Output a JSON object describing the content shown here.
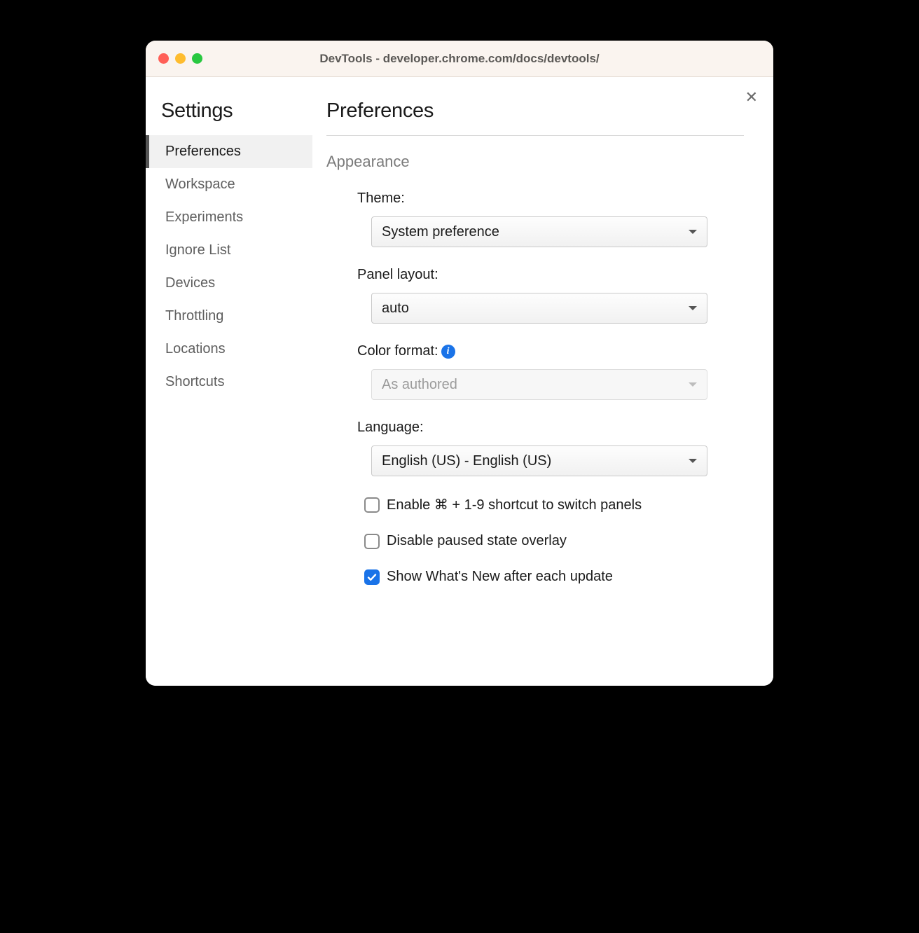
{
  "window": {
    "title": "DevTools - developer.chrome.com/docs/devtools/"
  },
  "sidebar": {
    "title": "Settings",
    "items": [
      {
        "label": "Preferences",
        "active": true
      },
      {
        "label": "Workspace",
        "active": false
      },
      {
        "label": "Experiments",
        "active": false
      },
      {
        "label": "Ignore List",
        "active": false
      },
      {
        "label": "Devices",
        "active": false
      },
      {
        "label": "Throttling",
        "active": false
      },
      {
        "label": "Locations",
        "active": false
      },
      {
        "label": "Shortcuts",
        "active": false
      }
    ]
  },
  "main": {
    "title": "Preferences",
    "section": "Appearance",
    "fields": {
      "theme": {
        "label": "Theme:",
        "value": "System preference",
        "disabled": false
      },
      "panel_layout": {
        "label": "Panel layout:",
        "value": "auto",
        "disabled": false
      },
      "color_format": {
        "label": "Color format:",
        "value": "As authored",
        "disabled": true,
        "info": true
      },
      "language": {
        "label": "Language:",
        "value": "English (US) - English (US)",
        "disabled": false
      }
    },
    "checkboxes": [
      {
        "label": "Enable ⌘ + 1-9 shortcut to switch panels",
        "checked": false
      },
      {
        "label": "Disable paused state overlay",
        "checked": false
      },
      {
        "label": "Show What's New after each update",
        "checked": true
      }
    ]
  }
}
